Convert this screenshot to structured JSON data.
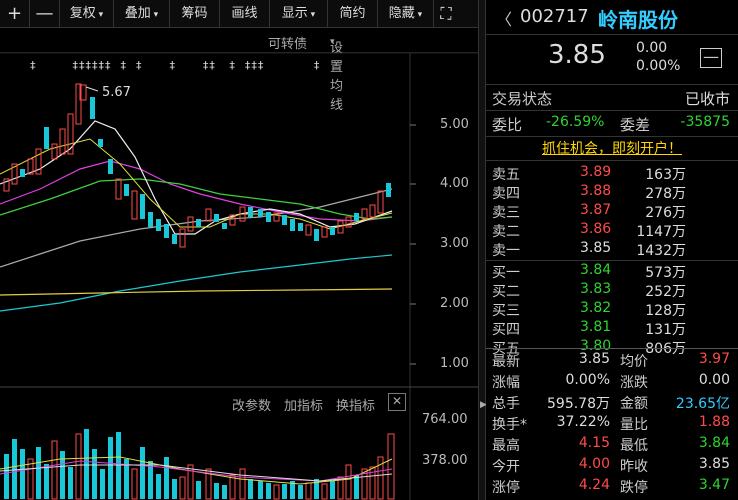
{
  "toolbar": {
    "plus_icon": "+",
    "minus_icon": "—",
    "fuquan": "复权",
    "diejia": "叠加",
    "choumai": "筹码",
    "huaxian": "画线",
    "xianshi": "显示",
    "jianyue": "简约",
    "yincang": "隐藏",
    "fullscreen_icon": "⛶"
  },
  "chart": {
    "convertible": "可转债",
    "ma_settings": "设置均线",
    "peak_label": "5.67",
    "y_ticks": [
      "5.00",
      "4.00",
      "3.00",
      "2.00",
      "1.00"
    ],
    "markers": "‡        ‡‡‡‡‡‡  ‡  ‡      ‡      ‡‡   ‡  ‡‡‡           ‡",
    "indicator_bar": {
      "change_params": "改参数",
      "add_indicator": "加指标",
      "switch_indicator": "换指标"
    },
    "vol_ticks": [
      "764.00",
      "378.00"
    ]
  },
  "header": {
    "code": "002717",
    "name": "岭南股份",
    "price": "3.85",
    "change": "0.00",
    "change_pct": "0.00%"
  },
  "status": {
    "label": "交易状态",
    "value": "已收市",
    "weibi_label": "委比",
    "weibi_value": "-26.59%",
    "weicha_label": "委差",
    "weicha_value": "-35875"
  },
  "promo": "抓住机会，即刻开户！",
  "order_book": {
    "asks": [
      {
        "label": "卖五",
        "price": "3.89",
        "vol": "163万"
      },
      {
        "label": "卖四",
        "price": "3.88",
        "vol": "278万"
      },
      {
        "label": "卖三",
        "price": "3.87",
        "vol": "276万"
      },
      {
        "label": "卖二",
        "price": "3.86",
        "vol": "1147万"
      },
      {
        "label": "卖一",
        "price": "3.85",
        "vol": "1432万"
      }
    ],
    "bids": [
      {
        "label": "买一",
        "price": "3.84",
        "vol": "573万"
      },
      {
        "label": "买二",
        "price": "3.83",
        "vol": "252万"
      },
      {
        "label": "买三",
        "price": "3.82",
        "vol": "128万"
      },
      {
        "label": "买四",
        "price": "3.81",
        "vol": "131万"
      },
      {
        "label": "买五",
        "price": "3.80",
        "vol": "806万"
      }
    ]
  },
  "stats": [
    {
      "l1": "最新",
      "v1": "3.85",
      "l2": "均价",
      "v2": "3.97"
    },
    {
      "l1": "涨幅",
      "v1": "0.00%",
      "l2": "涨跌",
      "v2": "0.00"
    },
    {
      "l1": "总手",
      "v1": "595.78万",
      "l2": "金额",
      "v2": "23.65亿"
    },
    {
      "l1": "换手*",
      "v1": "37.22%",
      "l2": "量比",
      "v2": "1.88"
    },
    {
      "l1": "最高",
      "v1": "4.15",
      "l2": "最低",
      "v2": "3.84"
    },
    {
      "l1": "今开",
      "v1": "4.00",
      "l2": "昨收",
      "v2": "3.85"
    },
    {
      "l1": "涨停",
      "v1": "4.24",
      "l2": "跌停",
      "v2": "3.47"
    }
  ],
  "colors": {
    "up": "#ff4b4b",
    "down": "#2ed42e",
    "accent": "#33ccff"
  }
}
